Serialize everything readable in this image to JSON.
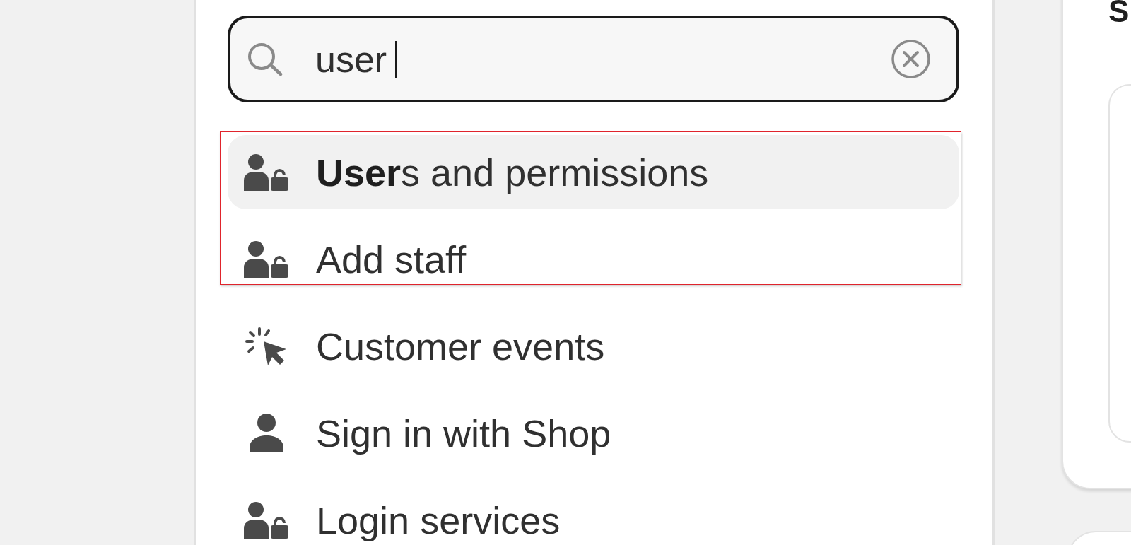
{
  "search": {
    "value": "user",
    "focused": true
  },
  "results": [
    {
      "label": "**User**s and permissions",
      "kind": "permission",
      "selected": true,
      "outlined": true
    },
    {
      "label": "Add staff",
      "kind": "permission",
      "selected": false,
      "outlined": true
    },
    {
      "label": "Customer events",
      "kind": "event",
      "selected": false,
      "outlined": false
    },
    {
      "label": "Sign in with Shop",
      "kind": "account",
      "selected": false,
      "outlined": false
    },
    {
      "label": "Login services",
      "kind": "permission",
      "selected": false,
      "outlined": false
    }
  ],
  "side_card": {
    "heading": "S"
  }
}
